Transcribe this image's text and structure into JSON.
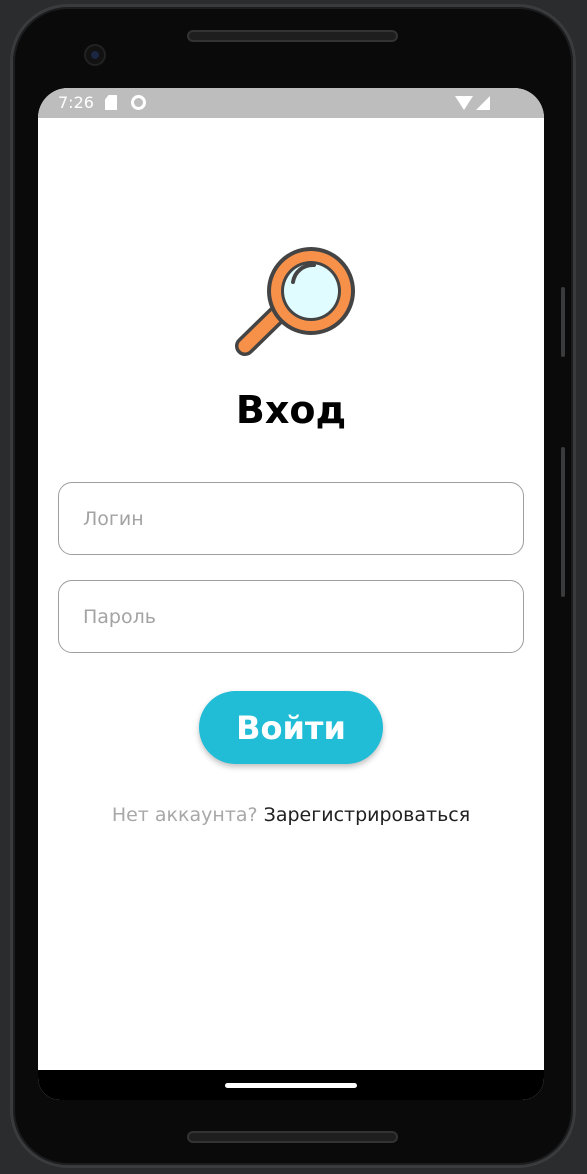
{
  "status_bar": {
    "time": "7:26",
    "icons": [
      "sd-card-icon",
      "robot-icon",
      "wifi-icon",
      "signal-icon"
    ]
  },
  "logo": {
    "icon": "magnifier-icon",
    "colors": {
      "handle": "#f7914a",
      "lens": "#e0fcff",
      "outline": "#444444"
    }
  },
  "title": "Вход",
  "form": {
    "login_placeholder": "Логин",
    "login_value": "",
    "password_placeholder": "Пароль",
    "password_value": "",
    "submit_label": "Войти"
  },
  "register": {
    "prompt": "Нет аккаунта?",
    "link_label": "Зарегистрироваться"
  },
  "colors": {
    "accent": "#21bcd6",
    "status_bar_bg": "#bdbdbd",
    "placeholder_text": "#a3a3a3"
  }
}
